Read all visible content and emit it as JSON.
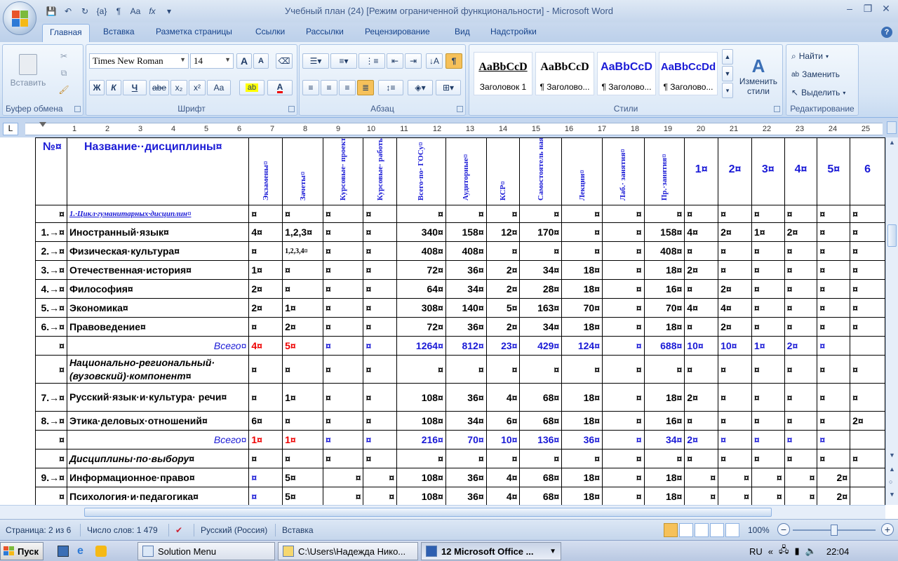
{
  "window": {
    "title": "Учебный план (24) [Режим ограниченной функциональности] - Microsoft Word",
    "minimize": "–",
    "maximize": "❐",
    "close": "✕"
  },
  "qat": {
    "save": "💾",
    "undo": "↶",
    "redo": "↻",
    "formula": "{a}",
    "para": "¶",
    "font": "Aa",
    "fx": "fx",
    "more": "▾"
  },
  "tabs": [
    "Главная",
    "Вставка",
    "Разметка страницы",
    "Ссылки",
    "Рассылки",
    "Рецензирование",
    "Вид",
    "Надстройки"
  ],
  "ribbon": {
    "clipboard": {
      "label": "Буфер обмена",
      "paste": "Вставить"
    },
    "font": {
      "label": "Шрифт",
      "font_name": "Times New Roman",
      "font_size": "14",
      "bold": "Ж",
      "italic": "К",
      "underline": "Ч",
      "strike": "abe",
      "sub": "x₂",
      "sup": "x²",
      "case": "Aa",
      "grow": "A",
      "shrink": "A"
    },
    "paragraph": {
      "label": "Абзац",
      "pilcrow": "¶"
    },
    "styles": {
      "label": "Стили",
      "change_styles": "Изменить стили",
      "items": [
        {
          "sample": "AaBbCcD",
          "name": "Заголовок 1",
          "color": "#000000"
        },
        {
          "sample": "AaBbCcD",
          "name": "¶ Заголово...",
          "color": "#000000"
        },
        {
          "sample": "AaBbCcD",
          "name": "¶ Заголово...",
          "color": "#1a1ad6"
        },
        {
          "sample": "AaBbCcDd",
          "name": "¶ Заголово...",
          "color": "#1a1ad6"
        }
      ]
    },
    "editing": {
      "label": "Редактирование",
      "find": "Найти",
      "replace": "Заменить",
      "select": "Выделить"
    }
  },
  "ruler": {
    "tab_selector": "L",
    "numbers": [
      "1",
      "2",
      "3",
      "4",
      "5",
      "6",
      "7",
      "8",
      "9",
      "10",
      "11",
      "12",
      "13",
      "14",
      "15",
      "16",
      "17",
      "18",
      "19",
      "20",
      "21",
      "22",
      "23",
      "24",
      "25"
    ]
  },
  "table": {
    "header": {
      "no": "№¤",
      "name": "Название··дисциплины¤",
      "vertical": [
        "Экзамены¤",
        "Зачеты¤",
        "Курсовые· проекты¤",
        "Курсовые· работы¤",
        "Всего·по· ГОСу¤",
        "Аудиторные¤",
        "КСР¤",
        "Самостоятель ная·работа¤",
        "Лекции¤",
        "Лаб.· занятия¤",
        "Пр.·занятия¤"
      ],
      "semesters": [
        "1¤",
        "2¤",
        "3¤",
        "4¤",
        "5¤",
        "6"
      ]
    },
    "rows": [
      {
        "type": "section",
        "cells": [
          "¤",
          "1.·Цикл·гуманитарных·дисциплин¤",
          "¤",
          "¤",
          "¤",
          "¤",
          "¤",
          "¤",
          "¤",
          "¤",
          "¤",
          "¤",
          "¤",
          "¤",
          "¤",
          "¤",
          "¤",
          "¤",
          "¤"
        ]
      },
      {
        "type": "data",
        "cells": [
          "1.→¤",
          "Иностранный·язык¤",
          "4¤",
          "1,2,3¤",
          "¤",
          "¤",
          "340¤",
          "158¤",
          "12¤",
          "170¤",
          "¤",
          "¤",
          "158¤",
          "4¤",
          "2¤",
          "1¤",
          "2¤",
          "¤",
          "¤"
        ]
      },
      {
        "type": "data",
        "cells": [
          "2.→¤",
          "Физическая·культура¤",
          "¤",
          "1,2,3,4¤",
          "¤",
          "¤",
          "408¤",
          "408¤",
          "¤",
          "¤",
          "¤",
          "¤",
          "408¤",
          "¤",
          "¤",
          "¤",
          "¤",
          "¤",
          "¤"
        ]
      },
      {
        "type": "data",
        "cells": [
          "3.→¤",
          "Отечественная·история¤",
          "1¤",
          "¤",
          "¤",
          "¤",
          "72¤",
          "36¤",
          "2¤",
          "34¤",
          "18¤",
          "¤",
          "18¤",
          "2¤",
          "¤",
          "¤",
          "¤",
          "¤",
          "¤"
        ]
      },
      {
        "type": "data",
        "cells": [
          "4.→¤",
          "Философия¤",
          "2¤",
          "¤",
          "¤",
          "¤",
          "64¤",
          "34¤",
          "2¤",
          "28¤",
          "18¤",
          "¤",
          "16¤",
          "¤",
          "2¤",
          "¤",
          "¤",
          "¤",
          "¤"
        ]
      },
      {
        "type": "data",
        "cells": [
          "5.→¤",
          "Экономика¤",
          "2¤",
          "1¤",
          "¤",
          "¤",
          "308¤",
          "140¤",
          "5¤",
          "163¤",
          "70¤",
          "¤",
          "70¤",
          "4¤",
          "4¤",
          "¤",
          "¤",
          "¤",
          "¤"
        ]
      },
      {
        "type": "data",
        "cells": [
          "6.→¤",
          "Правоведение¤",
          "¤",
          "2¤",
          "¤",
          "¤",
          "72¤",
          "36¤",
          "2¤",
          "34¤",
          "18¤",
          "¤",
          "18¤",
          "¤",
          "2¤",
          "¤",
          "¤",
          "¤",
          "¤"
        ]
      },
      {
        "type": "total",
        "cells": [
          "¤",
          "Всего¤",
          "4¤",
          "5¤",
          "¤",
          "¤",
          "1264¤",
          "812¤",
          "23¤",
          "429¤",
          "124¤",
          "¤",
          "688¤",
          "10¤",
          "10¤",
          "1¤",
          "2¤",
          "¤",
          ""
        ]
      },
      {
        "type": "subsection",
        "cells": [
          "¤",
          "Национально-региональный· (вузовский)·компонент¤",
          "¤",
          "¤",
          "¤",
          "¤",
          "¤",
          "¤",
          "¤",
          "¤",
          "¤",
          "¤",
          "¤",
          "¤",
          "¤",
          "¤",
          "¤",
          "¤",
          "¤"
        ]
      },
      {
        "type": "data2",
        "cells": [
          "7.→¤",
          "Русский·язык·и·культура· речи¤",
          "¤",
          "1¤",
          "¤",
          "¤",
          "108¤",
          "36¤",
          "4¤",
          "68¤",
          "18¤",
          "¤",
          "18¤",
          "2¤",
          "¤",
          "¤",
          "¤",
          "¤",
          "¤"
        ]
      },
      {
        "type": "data",
        "cells": [
          "8.→¤",
          "Этика·деловых·отношений¤",
          "6¤",
          "¤",
          "¤",
          "¤",
          "108¤",
          "34¤",
          "6¤",
          "68¤",
          "18¤",
          "¤",
          "16¤",
          "¤",
          "¤",
          "¤",
          "¤",
          "¤",
          "2¤"
        ]
      },
      {
        "type": "total",
        "cells": [
          "¤",
          "Всего¤",
          "1¤",
          "1¤",
          "¤",
          "¤",
          "216¤",
          "70¤",
          "10¤",
          "136¤",
          "36¤",
          "¤",
          "34¤",
          "2¤",
          "¤",
          "¤",
          "¤",
          "¤",
          ""
        ]
      },
      {
        "type": "subsection",
        "cells": [
          "¤",
          "Дисциплины·по·выбору¤",
          "¤",
          "¤",
          "¤",
          "¤",
          "¤",
          "¤",
          "¤",
          "¤",
          "¤",
          "¤",
          "¤",
          "¤",
          "¤",
          "¤",
          "¤",
          "¤",
          "¤"
        ]
      },
      {
        "type": "data",
        "cells": [
          "9.→¤",
          "Информационное·право¤",
          "¤",
          "5¤",
          "¤",
          "¤",
          "108¤",
          "36¤",
          "4¤",
          "68¤",
          "18¤",
          "¤",
          "18¤",
          "¤",
          "¤",
          "¤",
          "¤",
          "2¤",
          ""
        ]
      },
      {
        "type": "data",
        "cells": [
          "¤",
          "Психология·и·педагогика¤",
          "¤",
          "5¤",
          "¤",
          "¤",
          "108¤",
          "36¤",
          "4¤",
          "68¤",
          "18¤",
          "¤",
          "18¤",
          "¤",
          "¤",
          "¤",
          "¤",
          "2¤",
          ""
        ]
      }
    ]
  },
  "status": {
    "page": "Страница: 2 из 6",
    "words": "Число слов: 1 479",
    "language": "Русский (Россия)",
    "mode": "Вставка",
    "zoom": "100%",
    "zoom_level": 1.0
  },
  "taskbar": {
    "start": "Пуск",
    "tasks": [
      "Solution Menu",
      "C:\\Users\\Надежда Нико...",
      "12 Microsoft Office ..."
    ],
    "lang": "RU",
    "time": "22:04"
  }
}
